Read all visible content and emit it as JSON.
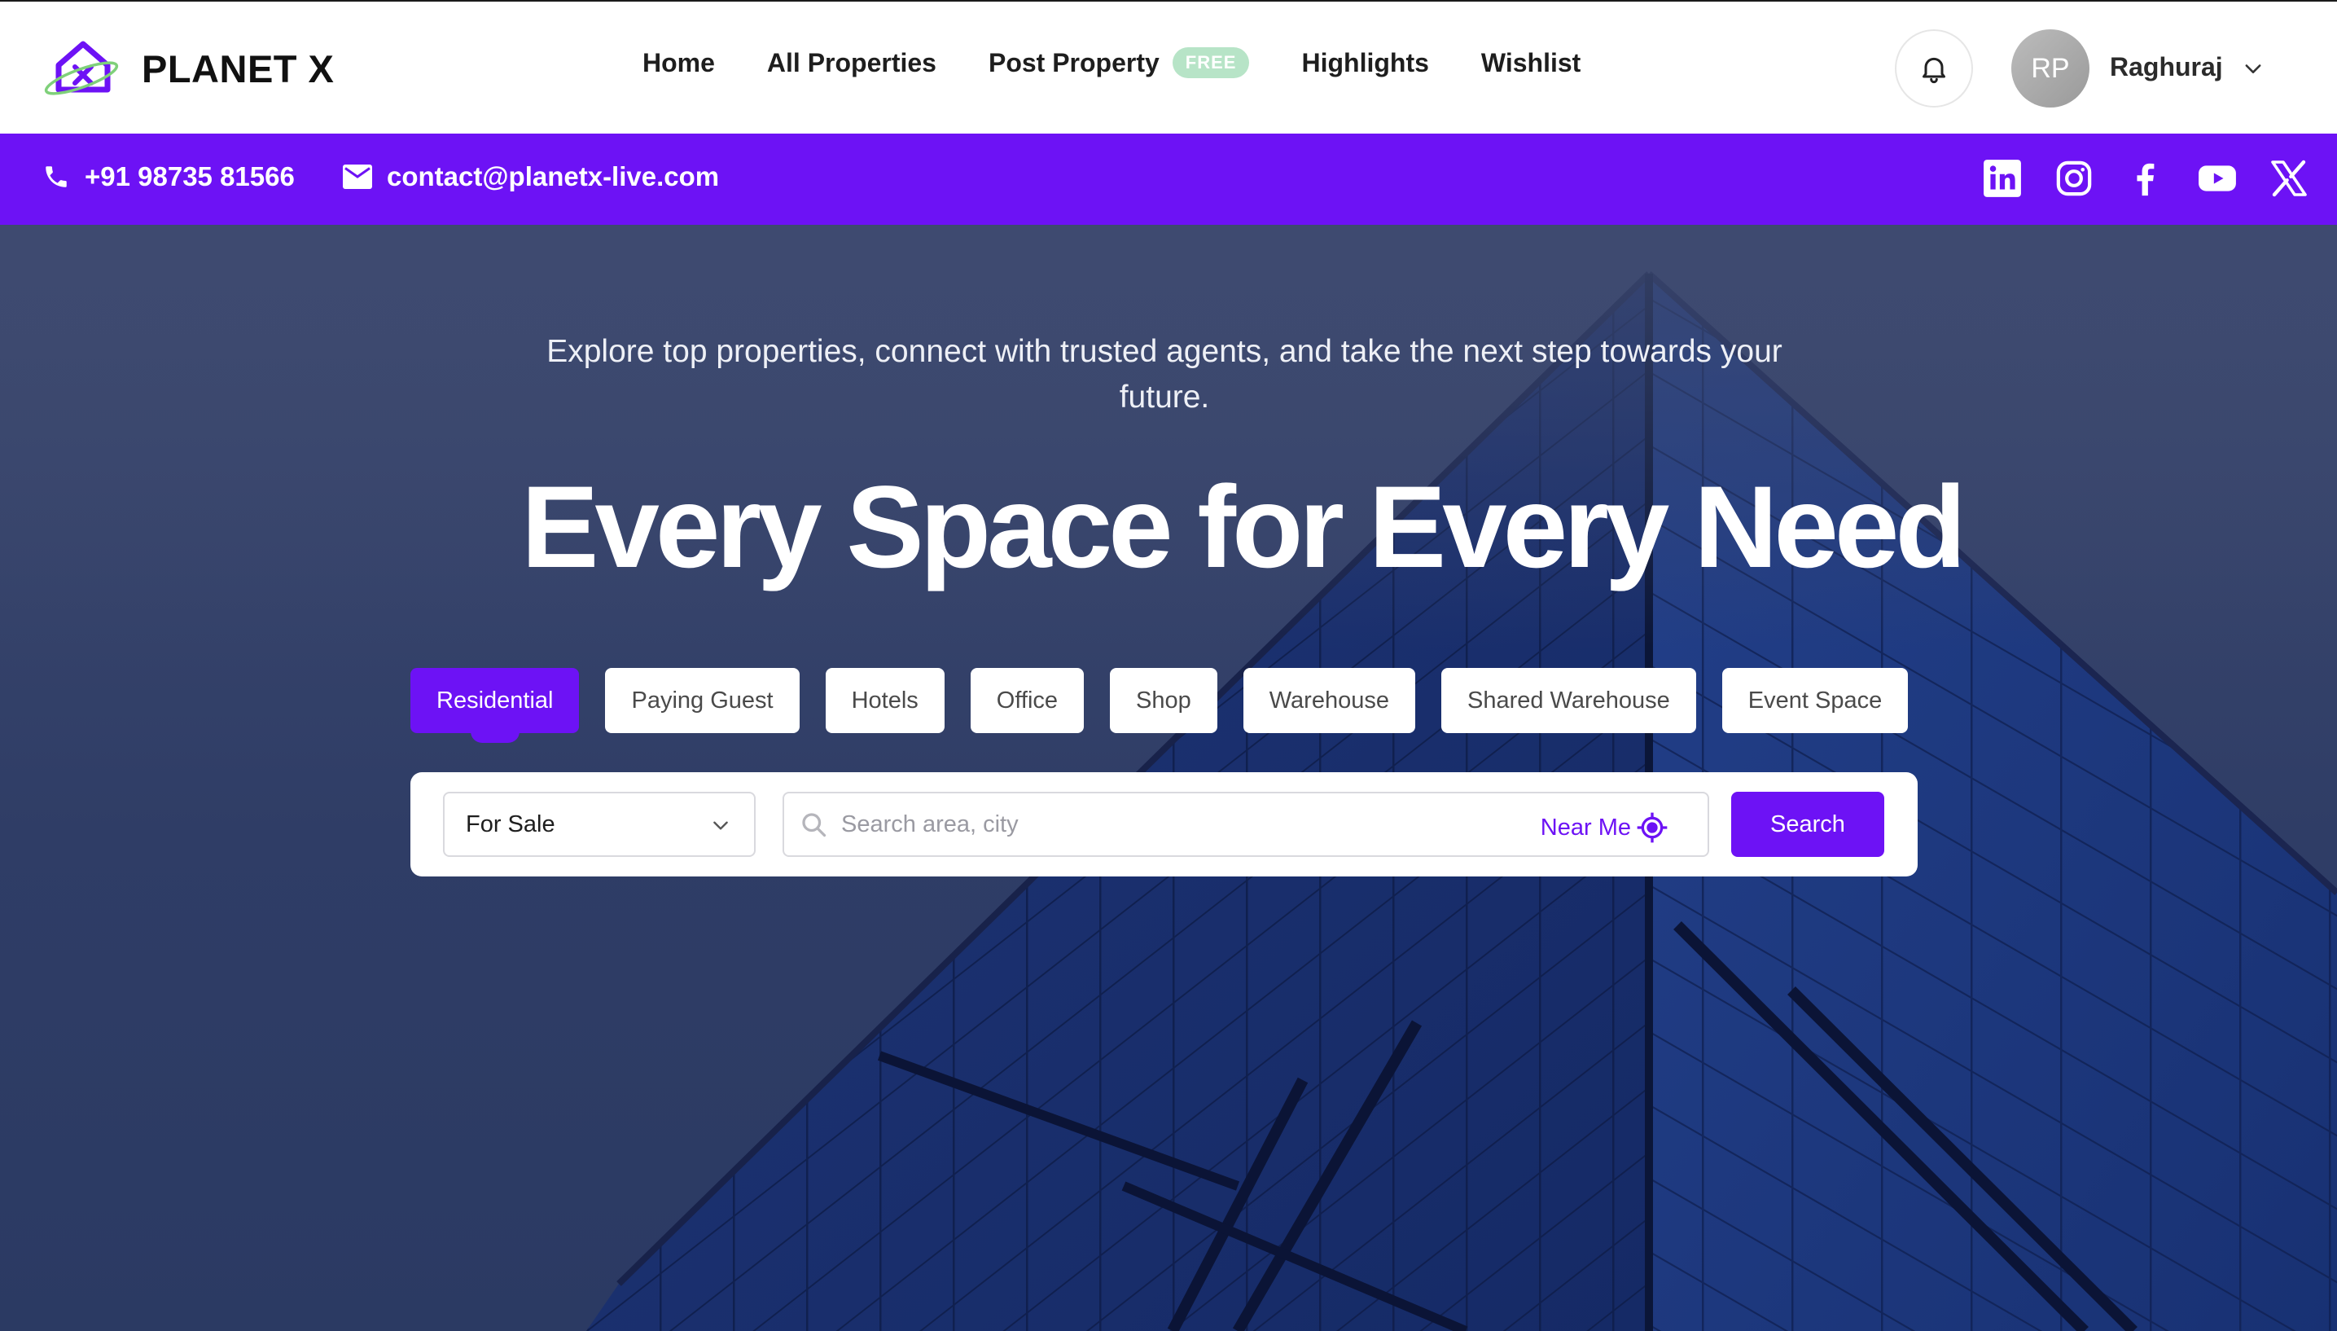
{
  "brand": {
    "name": "PLANET X",
    "logo_icon": "house-x-logo-icon"
  },
  "nav": {
    "links": [
      {
        "label": "Home"
      },
      {
        "label": "All Properties"
      },
      {
        "label": "Post Property",
        "badge": "FREE"
      },
      {
        "label": "Highlights"
      },
      {
        "label": "Wishlist"
      }
    ],
    "notification_icon": "bell-icon"
  },
  "user": {
    "initials": "RP",
    "name": "Raghuraj"
  },
  "contact": {
    "phone": "+91 98735 81566",
    "email": "contact@planetx-live.com",
    "socials": [
      "linkedin-icon",
      "instagram-icon",
      "facebook-icon",
      "youtube-icon",
      "x-icon"
    ]
  },
  "hero": {
    "subtitle": "Explore top properties, connect with trusted agents, and take the next step towards your future.",
    "title": "Every Space for Every Need"
  },
  "property_tabs": {
    "active_index": 0,
    "items": [
      "Residential",
      "Paying Guest",
      "Hotels",
      "Office",
      "Shop",
      "Warehouse",
      "Shared Warehouse",
      "Event Space"
    ]
  },
  "search": {
    "listing_type": "For Sale",
    "placeholder": "Search area, city",
    "value": "",
    "near_me_label": "Near Me",
    "button_label": "Search"
  },
  "colors": {
    "brand_purple": "#6d12f5",
    "free_badge": "#b7e4c7",
    "nav_bg": "#ffffff"
  }
}
